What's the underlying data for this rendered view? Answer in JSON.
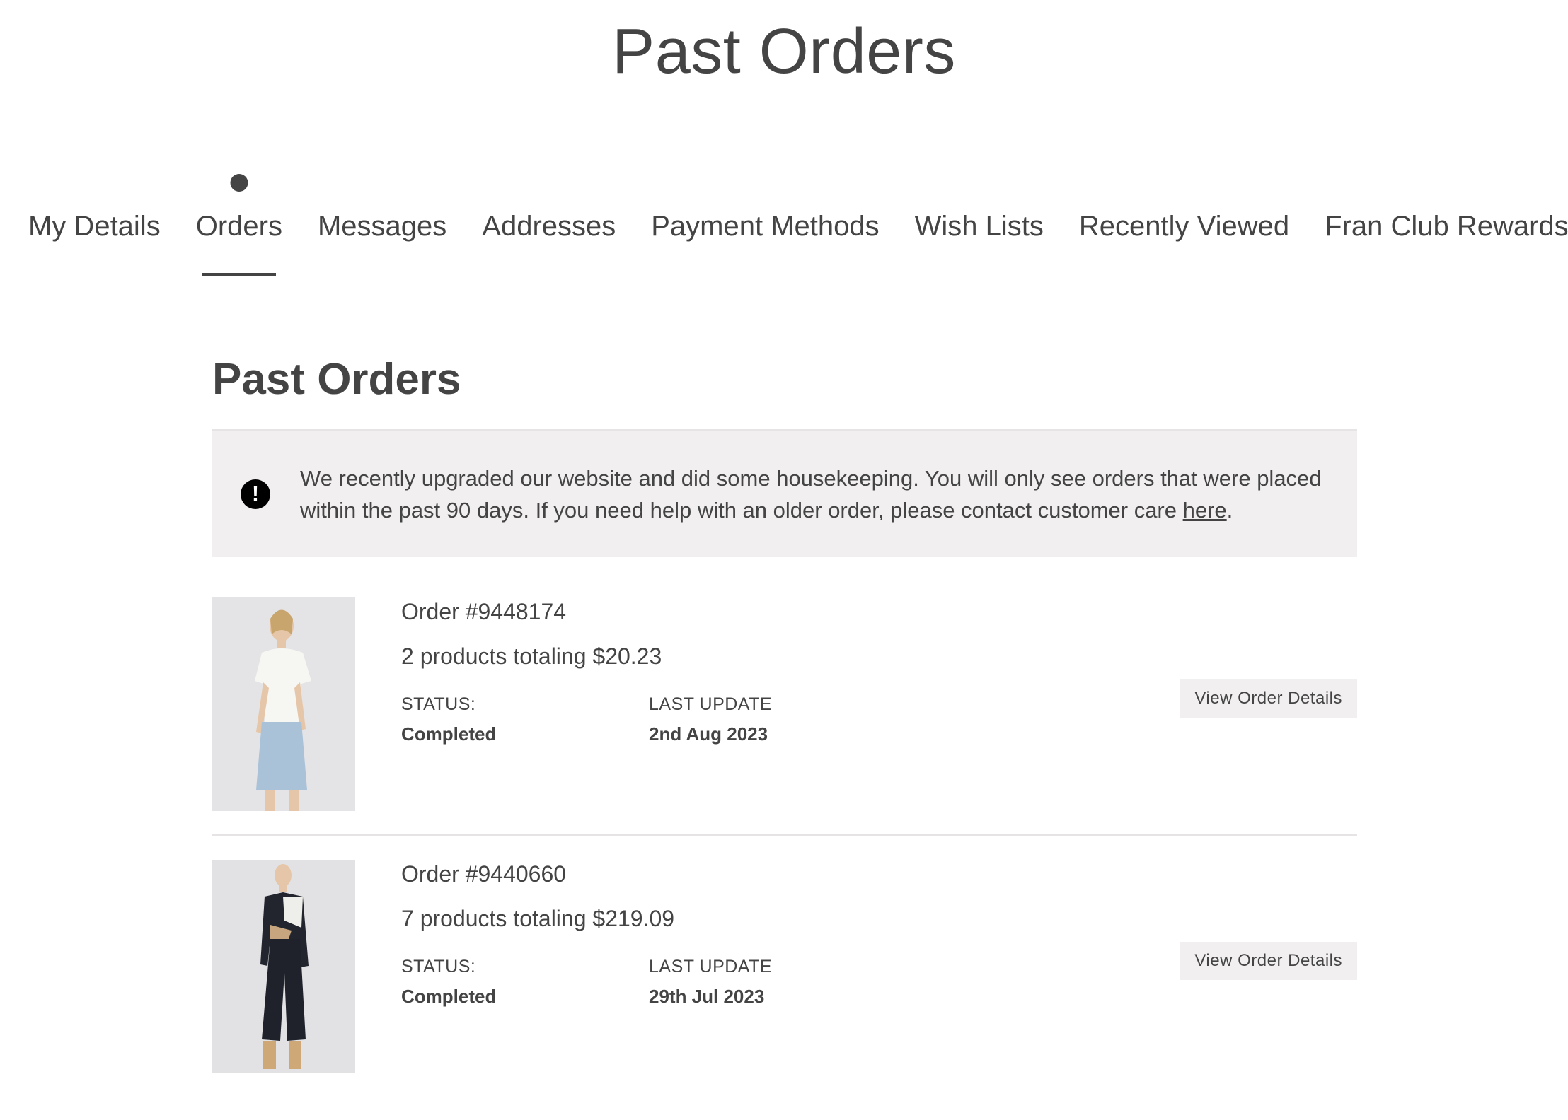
{
  "page": {
    "title": "Past Orders"
  },
  "tabs": [
    {
      "label": "My Details",
      "active": false
    },
    {
      "label": "Orders",
      "active": true
    },
    {
      "label": "Messages",
      "active": false
    },
    {
      "label": "Addresses",
      "active": false
    },
    {
      "label": "Payment Methods",
      "active": false
    },
    {
      "label": "Wish Lists",
      "active": false
    },
    {
      "label": "Recently Viewed",
      "active": false
    },
    {
      "label": "Fran Club Rewards",
      "active": false
    }
  ],
  "section": {
    "title": "Past Orders"
  },
  "notice": {
    "icon": "exclamation-circle-icon",
    "text": "We recently upgraded our website and did some housekeeping. You will only see orders that were placed within the past 90 days. If you need help with an older order, please contact customer care ",
    "link_label": "here",
    "trailing": "."
  },
  "orders": [
    {
      "number": "Order #9448174",
      "summary": "2 products totaling $20.23",
      "status_label": "STATUS:",
      "status": "Completed",
      "update_label": "LAST UPDATE",
      "last_update": "2nd Aug 2023",
      "button_label": "View Order Details",
      "image_alt": "Woman in white button-front tee and light denim skirt"
    },
    {
      "number": "Order #9440660",
      "summary": "7 products totaling $219.09",
      "status_label": "STATUS:",
      "status": "Completed",
      "update_label": "LAST UPDATE",
      "last_update": "29th Jul 2023",
      "button_label": "View Order Details",
      "image_alt": "Woman in black color-block twist sweater and black wide-leg pants"
    }
  ],
  "colors": {
    "text": "#444444",
    "notice_bg": "#f1eff0",
    "button_bg": "#f1eff0",
    "divider": "#e6e4e5",
    "icon_bg": "#000000"
  }
}
